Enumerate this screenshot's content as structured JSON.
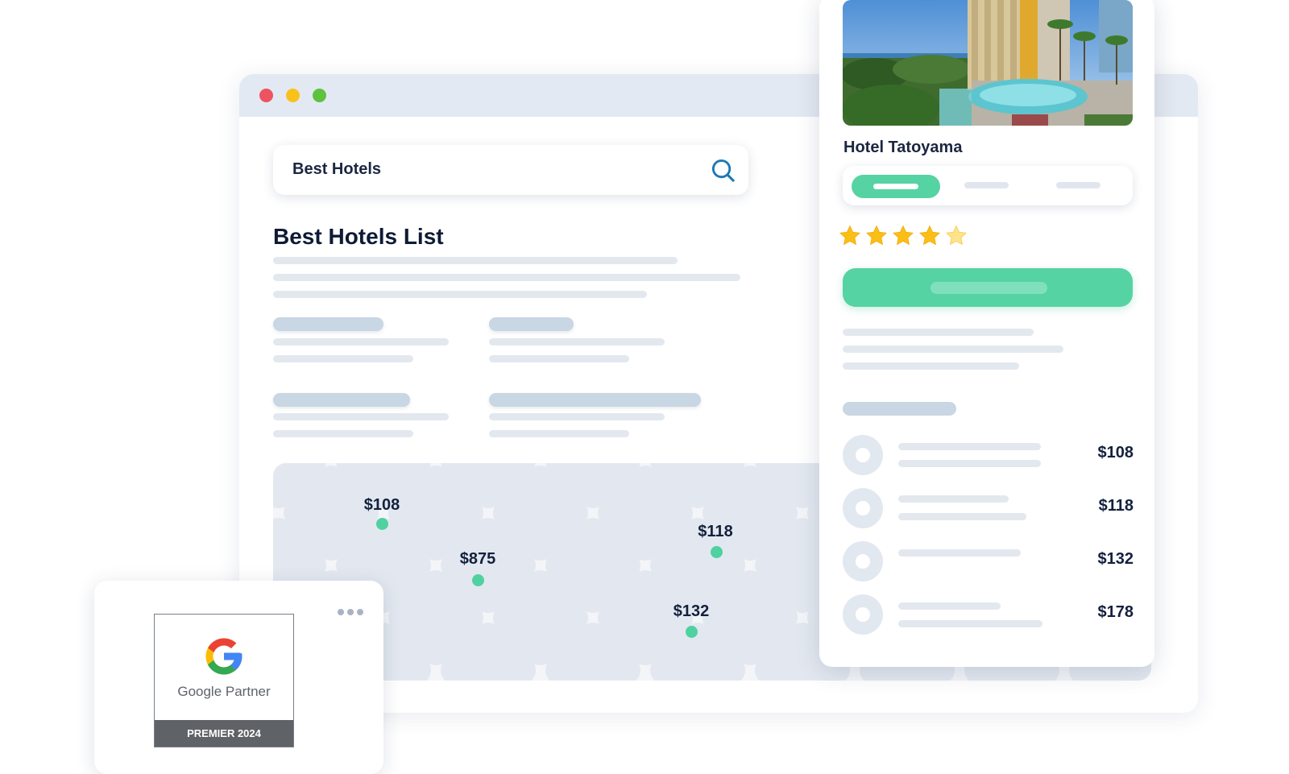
{
  "window": {
    "controls": [
      {
        "name": "close",
        "color": "#ee5362"
      },
      {
        "name": "minimize",
        "color": "#f8c21d"
      },
      {
        "name": "maximize",
        "color": "#5cc23f"
      }
    ]
  },
  "search": {
    "value": "Best Hotels",
    "icon": "search-icon"
  },
  "main": {
    "heading": "Best Hotels List"
  },
  "map": {
    "pins": [
      {
        "price": "$108"
      },
      {
        "price": "$875"
      },
      {
        "price": "$118"
      },
      {
        "price": "$132"
      }
    ]
  },
  "hotel_card": {
    "name": "Hotel Tatoyama",
    "rating": 4.5,
    "rating_max": 5,
    "rooms": [
      {
        "price": "$108"
      },
      {
        "price": "$118"
      },
      {
        "price": "$132"
      },
      {
        "price": "$178"
      }
    ]
  },
  "badge": {
    "brand": "Google Partner",
    "tier": "PREMIER 2024"
  },
  "colors": {
    "accent": "#56d3a3",
    "pin": "#4fd1a0",
    "text": "#14213d"
  }
}
